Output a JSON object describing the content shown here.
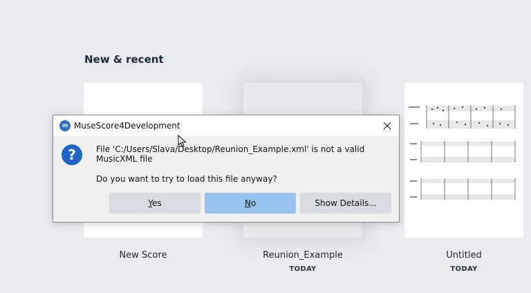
{
  "section": {
    "title": "New & recent"
  },
  "cards": [
    {
      "name": "New Score",
      "date": ""
    },
    {
      "name": "Reunion_Example",
      "date": "TODAY"
    },
    {
      "name": "Untitled",
      "date": "TODAY"
    }
  ],
  "dialog": {
    "title": "MuseScore4Development",
    "app_icon": "musescore-logo-icon",
    "message_line": "File 'C:/Users/Slava/Desktop/Reunion_Example.xml' is not a valid MusicXML file",
    "question": "Do you want to try to load this file anyway?",
    "buttons": {
      "yes_mnemonic": "Y",
      "yes_rest": "es",
      "no_mnemonic": "N",
      "no_rest": "o",
      "details": "Show Details..."
    },
    "icons": {
      "message": "question-icon",
      "close": "close-icon"
    }
  },
  "colors": {
    "background": "#e9ebef",
    "default_button": "#98c3ee",
    "button": "#d8dbe1",
    "question_icon": "#1e64c8"
  }
}
